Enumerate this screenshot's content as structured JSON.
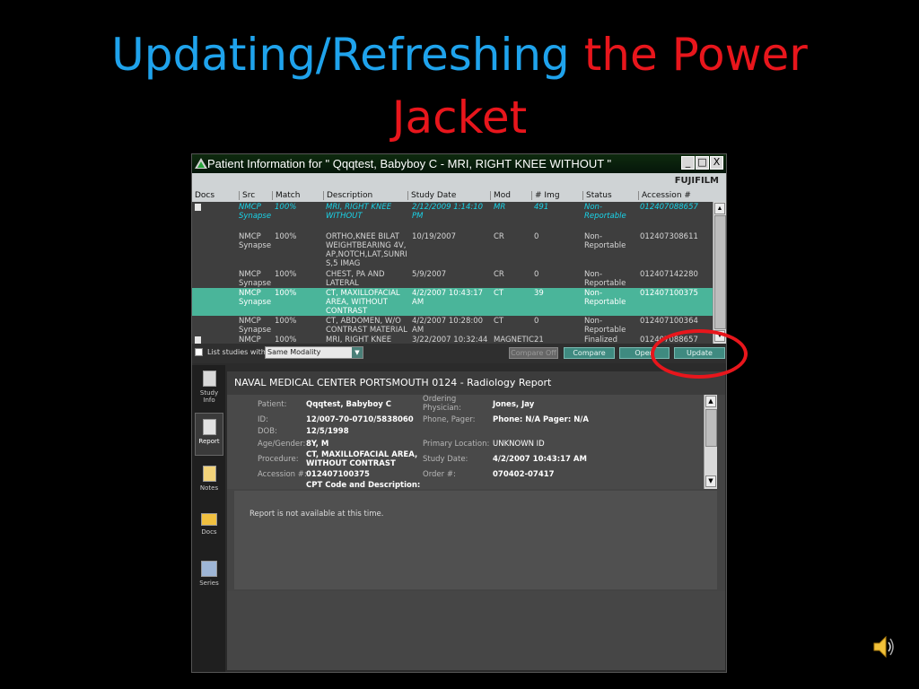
{
  "slide": {
    "title_part1": "Updating/Refreshing",
    "title_part2": "the Power",
    "title_line2": "Jacket"
  },
  "window": {
    "title": "Patient Information for \" Qqqtest, Babyboy C   - MRI, RIGHT KNEE WITHOUT \"",
    "brand": "FUJIFILM",
    "controls": {
      "minimize": "_",
      "maximize": "□",
      "close": "X"
    }
  },
  "grid": {
    "columns": [
      "Docs",
      "Src",
      "Match",
      "Description",
      "Study Date",
      "Mod",
      "# Img",
      "Status",
      "Accession #"
    ],
    "rows": [
      {
        "src": "NMCP Synapse",
        "match": "100%",
        "description": "MRI, RIGHT KNEE WITHOUT",
        "study_date": "2/12/2009 1:14:10 PM",
        "mod": "MR",
        "img": "491",
        "status": "Non-Reportable",
        "accession": "012407088657"
      },
      {
        "src": "NMCP Synapse",
        "match": "100%",
        "description": "ORTHO,KNEE BILAT WEIGHTBEARING 4V,AP,NOTCH,LAT,SUNRIS,5 IMAG",
        "study_date": "10/19/2007",
        "mod": "CR",
        "img": "0",
        "status": "Non-Reportable",
        "accession": "012407308611"
      },
      {
        "src": "NMCP Synapse",
        "match": "100%",
        "description": "CHEST, PA AND LATERAL",
        "study_date": "5/9/2007",
        "mod": "CR",
        "img": "0",
        "status": "Non-Reportable",
        "accession": "012407142280"
      },
      {
        "src": "NMCP Synapse",
        "match": "100%",
        "description": "CT, MAXILLOFACIAL AREA, WITHOUT CONTRAST",
        "study_date": "4/2/2007 10:43:17 AM",
        "mod": "CT",
        "img": "39",
        "status": "Non-Reportable",
        "accession": "012407100375"
      },
      {
        "src": "NMCP Synapse",
        "match": "100%",
        "description": "CT, ABDOMEN, W/O CONTRAST MATERIAL",
        "study_date": "4/2/2007 10:28:00 AM",
        "mod": "CT",
        "img": "0",
        "status": "Non-Reportable",
        "accession": "012407100364"
      },
      {
        "src": "NMCP",
        "match": "100%",
        "description": "MRI, RIGHT KNEE",
        "study_date": "3/22/2007 10:32:44",
        "mod": "MAGNETIC",
        "img": "21",
        "status": "Finalized",
        "accession": "012407088657"
      }
    ]
  },
  "filter": {
    "checkbox_label": "List studies with",
    "modality_value": "Same Modality",
    "buttons": {
      "compare_off": "Compare Off",
      "compare": "Compare",
      "open": "Open",
      "update": "Update"
    }
  },
  "nav": {
    "study_info": "Study Info",
    "report": "Report",
    "notes": "Notes",
    "docs": "Docs",
    "series": "Series"
  },
  "report": {
    "header": "NAVAL MEDICAL CENTER PORTSMOUTH 0124 - Radiology Report",
    "labels": {
      "patient": "Patient:",
      "id": "ID:",
      "dob": "DOB:",
      "age_gender": "Age/Gender:",
      "procedure": "Procedure:",
      "accession": "Accession #:",
      "cpt": "CPT Code and Description:",
      "ordering": "Ordering Physician:",
      "phone": "Phone, Pager:",
      "location": "Primary Location:",
      "study_date": "Study Date:",
      "order": "Order #:"
    },
    "values": {
      "patient": "Qqqtest, Babyboy C",
      "id": "12/007-70-0710/5838060",
      "dob": "12/5/1998",
      "age_gender": "8Y, M",
      "procedure": "CT, MAXILLOFACIAL AREA, WITHOUT CONTRAST",
      "accession": "012407100375",
      "ordering": "Jones, Jay",
      "phone": "Phone: N/A Pager: N/A",
      "location": "UNKNOWN ID",
      "study_date": "4/2/2007 10:43:17 AM",
      "order": "070402-07417"
    },
    "message": "Report is not available at this time."
  },
  "colors": {
    "title_blue": "#1fa3ec",
    "title_red": "#e8161c",
    "selected_row_text": "#19d3e8",
    "highlight_row": "#4ab59a",
    "button_green": "#3f8a80"
  },
  "icons": [
    "app-logo-icon",
    "study-info-icon",
    "report-icon",
    "notes-icon",
    "docs-folder-icon",
    "series-icon",
    "speaker-icon"
  ]
}
